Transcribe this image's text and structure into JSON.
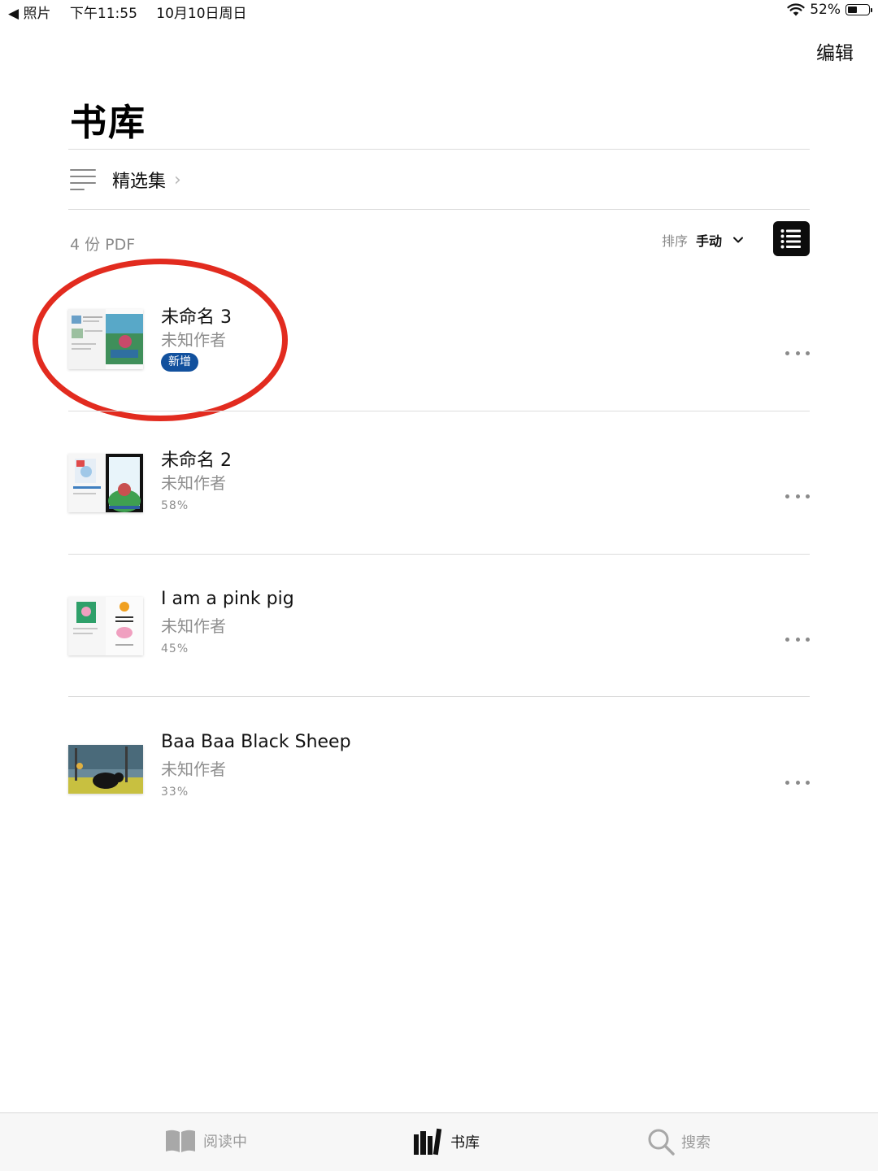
{
  "status_bar": {
    "back_label": "◀ 照片",
    "time": "下午11:55",
    "date": "10月10日周日",
    "battery": "52%",
    "battery_level": 0.52
  },
  "header": {
    "edit_label": "编辑",
    "title": "书库"
  },
  "collections": {
    "label": "精选集",
    "chevron": "›"
  },
  "toolbar": {
    "count_label": "4 份 PDF",
    "sort_label": "排序",
    "sort_value": "手动",
    "sort_chevron": "⌄"
  },
  "books": [
    {
      "title": "未命名 3",
      "author": "未知作者",
      "badge": "新增"
    },
    {
      "title": "未命名 2",
      "author": "未知作者",
      "progress": "58%"
    },
    {
      "title": "I am a pink pig",
      "author": "未知作者",
      "progress": "45%"
    },
    {
      "title": "Baa Baa Black Sheep",
      "author": "未知作者",
      "progress": "33%"
    }
  ],
  "tabbar": {
    "tabs": [
      {
        "label": "阅读中",
        "icon": "open-book-icon"
      },
      {
        "label": "书库",
        "icon": "library-books-icon"
      },
      {
        "label": "搜索",
        "icon": "search-icon"
      }
    ],
    "active_index": 1
  },
  "colors": {
    "accent_badge": "#12519e",
    "highlight_circle": "#e22b1f",
    "secondary_text": "#8e8e8e"
  }
}
